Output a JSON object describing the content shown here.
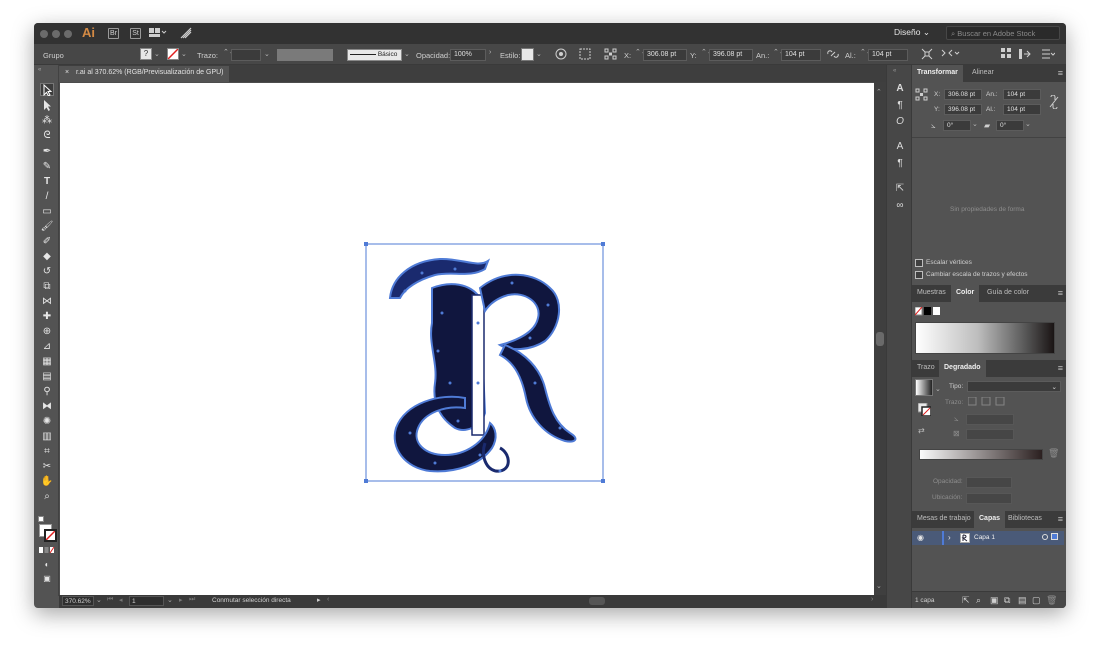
{
  "app": {
    "logo": "Ai",
    "bridge_icon": "Br",
    "stock_icon": "St",
    "workspace": "Diseño",
    "stock_search_placeholder": "Buscar en Adobe Stock"
  },
  "control_bar": {
    "selection_label": "Grupo",
    "stroke_label": "Trazo:",
    "stroke_profile": "Básico",
    "opacity_label": "Opacidad:",
    "opacity_value": "100%",
    "style_label": "Estilo:",
    "x_label": "X:",
    "x_value": "306.08 pt",
    "y_label": "Y:",
    "y_value": "396.08 pt",
    "width_label": "An.:",
    "width_value": "104 pt",
    "height_label": "Al.:",
    "height_value": "104 pt"
  },
  "document": {
    "close_glyph": "×",
    "tab_title": "r.ai al 370.62% (RGB/Previsualización de GPU)"
  },
  "status_bar": {
    "zoom": "370.62%",
    "artboard_number": "1",
    "status_text": "Conmutar selección directa"
  },
  "panels": {
    "transform": {
      "tabs": [
        "Transformar",
        "Alinear"
      ],
      "x_label": "X:",
      "x_value": "306.08 pt",
      "y_label": "Y:",
      "y_value": "396.08 pt",
      "width_label": "An.:",
      "width_value": "104 pt",
      "height_label": "Al.:",
      "height_value": "104 pt",
      "angle_value": "0°",
      "shear_value": "0°",
      "no_shape_text": "Sin propiedades de forma",
      "scale_corners": "Escalar vértices",
      "scale_strokes": "Cambiar escala de trazos y efectos"
    },
    "color": {
      "tabs": [
        "Muestras",
        "Color",
        "Guía de color"
      ]
    },
    "gradient": {
      "tabs": [
        "Trazo",
        "Degradado"
      ],
      "type_label": "Tipo:",
      "stroke_label": "Trazo:",
      "opacity_label": "Opacidad:",
      "location_label": "Ubicación:"
    },
    "layers": {
      "tabs": [
        "Mesas de trabajo",
        "Capas",
        "Bibliotecas"
      ],
      "layer_name": "Capa 1",
      "footer_count": "1 capa",
      "layer_color": "#4f7bd6"
    }
  },
  "colors": {
    "selection": "#4f7bd6",
    "ai_brand": "#d48a44"
  }
}
